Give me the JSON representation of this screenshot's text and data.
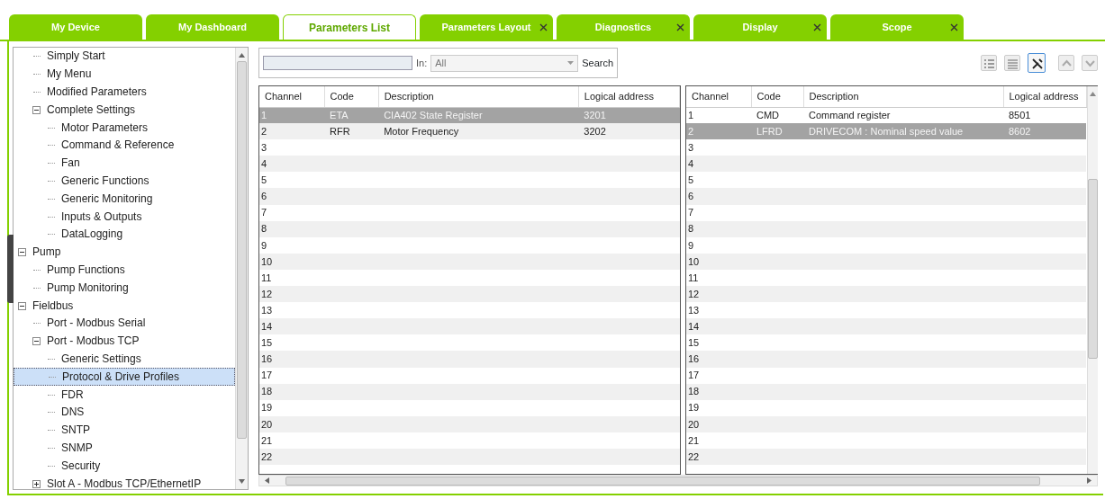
{
  "tabs": [
    {
      "label": "My Device",
      "selected": false,
      "closable": false
    },
    {
      "label": "My Dashboard",
      "selected": false,
      "closable": false
    },
    {
      "label": "Parameters List",
      "selected": true,
      "closable": false
    },
    {
      "label": "Parameters Layout",
      "selected": false,
      "closable": true
    },
    {
      "label": "Diagnostics",
      "selected": false,
      "closable": true
    },
    {
      "label": "Display",
      "selected": false,
      "closable": true
    },
    {
      "label": "Scope",
      "selected": false,
      "closable": true
    }
  ],
  "tree": [
    {
      "children": [
        {
          "label": "Simply Start",
          "selected": false
        },
        {
          "label": "My Menu",
          "selected": false
        },
        {
          "label": "Modified Parameters",
          "selected": false
        },
        {
          "label": "Complete Settings",
          "selected": false,
          "expanded": true,
          "children": [
            {
              "label": "Motor Parameters",
              "selected": false
            },
            {
              "label": "Command & Reference",
              "selected": false
            },
            {
              "label": "Fan",
              "selected": false
            },
            {
              "label": "Generic Functions",
              "selected": false
            },
            {
              "label": "Generic Monitoring",
              "selected": false
            },
            {
              "label": "Inputs & Outputs",
              "selected": false
            },
            {
              "label": "DataLogging",
              "selected": false
            }
          ]
        }
      ]
    },
    {
      "label": "Pump",
      "selected": false,
      "expanded": true,
      "children": [
        {
          "label": "Pump Functions",
          "selected": false
        },
        {
          "label": "Pump Monitoring",
          "selected": false
        }
      ]
    },
    {
      "label": "Fieldbus",
      "selected": false,
      "expanded": true,
      "children": [
        {
          "label": "Port - Modbus Serial",
          "selected": false
        },
        {
          "label": "Port - Modbus TCP",
          "selected": false,
          "expanded": true,
          "children": [
            {
              "label": "Generic Settings",
              "selected": false
            },
            {
              "label": "Protocol & Drive Profiles",
              "selected": true
            },
            {
              "label": "FDR",
              "selected": false
            },
            {
              "label": "DNS",
              "selected": false
            },
            {
              "label": "SNTP",
              "selected": false
            },
            {
              "label": "SNMP",
              "selected": false
            },
            {
              "label": "Security",
              "selected": false
            }
          ]
        },
        {
          "label": "Slot A - Modbus TCP/EthernetIP",
          "selected": false,
          "expanded": false
        }
      ]
    }
  ],
  "search": {
    "in_label": "In:",
    "scope": "All",
    "button": "Search"
  },
  "toolbar_buttons": [
    {
      "kind": "list",
      "selected": false
    },
    {
      "kind": "rows",
      "selected": false
    },
    {
      "kind": "tools",
      "selected": true
    },
    {
      "kind": "up",
      "selected": false
    },
    {
      "kind": "down",
      "selected": false
    }
  ],
  "tables": [
    {
      "columns": [
        "Channel",
        "Code",
        "Description",
        "Logical address"
      ],
      "rows": [
        {
          "channel": "1",
          "code": "ETA",
          "description": "CIA402 State Register",
          "address": "3201",
          "selected": true
        },
        {
          "channel": "2",
          "code": "RFR",
          "description": "Motor Frequency",
          "address": "3202",
          "selected": false
        },
        {
          "channel": "3",
          "selected": false
        },
        {
          "channel": "4",
          "selected": false
        },
        {
          "channel": "5",
          "selected": false
        },
        {
          "channel": "6",
          "selected": false
        },
        {
          "channel": "7",
          "selected": false
        },
        {
          "channel": "8",
          "selected": false
        },
        {
          "channel": "9",
          "selected": false
        },
        {
          "channel": "10",
          "selected": false
        },
        {
          "channel": "11",
          "selected": false
        },
        {
          "channel": "12",
          "selected": false
        },
        {
          "channel": "13",
          "selected": false
        },
        {
          "channel": "14",
          "selected": false
        },
        {
          "channel": "15",
          "selected": false
        },
        {
          "channel": "16",
          "selected": false
        },
        {
          "channel": "17",
          "selected": false
        },
        {
          "channel": "18",
          "selected": false
        },
        {
          "channel": "19",
          "selected": false
        },
        {
          "channel": "20",
          "selected": false
        },
        {
          "channel": "21",
          "selected": false
        },
        {
          "channel": "22",
          "selected": false
        }
      ]
    },
    {
      "columns": [
        "Channel",
        "Code",
        "Description",
        "Logical address"
      ],
      "rows": [
        {
          "channel": "1",
          "code": "CMD",
          "description": "Command register",
          "address": "8501",
          "selected": false
        },
        {
          "channel": "2",
          "code": "LFRD",
          "description": "DRIVECOM : Nominal speed value",
          "address": "8602",
          "selected": true
        },
        {
          "channel": "3",
          "selected": false
        },
        {
          "channel": "4",
          "selected": false
        },
        {
          "channel": "5",
          "selected": false
        },
        {
          "channel": "6",
          "selected": false
        },
        {
          "channel": "7",
          "selected": false
        },
        {
          "channel": "8",
          "selected": false
        },
        {
          "channel": "9",
          "selected": false
        },
        {
          "channel": "10",
          "selected": false
        },
        {
          "channel": "11",
          "selected": false
        },
        {
          "channel": "12",
          "selected": false
        },
        {
          "channel": "13",
          "selected": false
        },
        {
          "channel": "14",
          "selected": false
        },
        {
          "channel": "15",
          "selected": false
        },
        {
          "channel": "16",
          "selected": false
        },
        {
          "channel": "17",
          "selected": false
        },
        {
          "channel": "18",
          "selected": false
        },
        {
          "channel": "19",
          "selected": false
        },
        {
          "channel": "20",
          "selected": false
        },
        {
          "channel": "21",
          "selected": false
        },
        {
          "channel": "22",
          "selected": false
        }
      ]
    }
  ]
}
